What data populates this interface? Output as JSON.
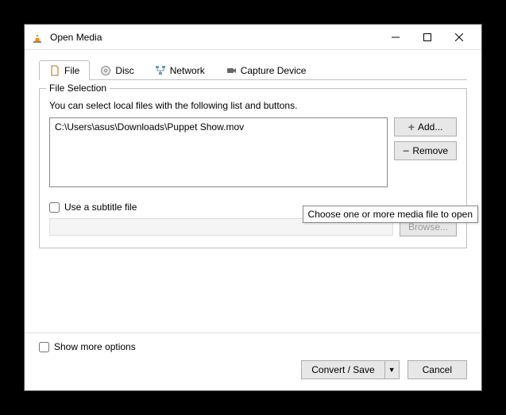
{
  "window": {
    "title": "Open Media"
  },
  "tabs": {
    "file": "File",
    "disc": "Disc",
    "network": "Network",
    "capture": "Capture Device"
  },
  "fileSelection": {
    "legend": "File Selection",
    "helper": "You can select local files with the following list and buttons.",
    "files": [
      "C:\\Users\\asus\\Downloads\\Puppet Show.mov"
    ],
    "addLabel": "Add...",
    "removeLabel": "Remove",
    "subtitleCheckbox": "Use a subtitle file",
    "browseLabel": "Browse...",
    "tooltip": "Choose one or more media file to open"
  },
  "footer": {
    "showMore": "Show more options",
    "convert": "Convert / Save",
    "cancel": "Cancel"
  }
}
